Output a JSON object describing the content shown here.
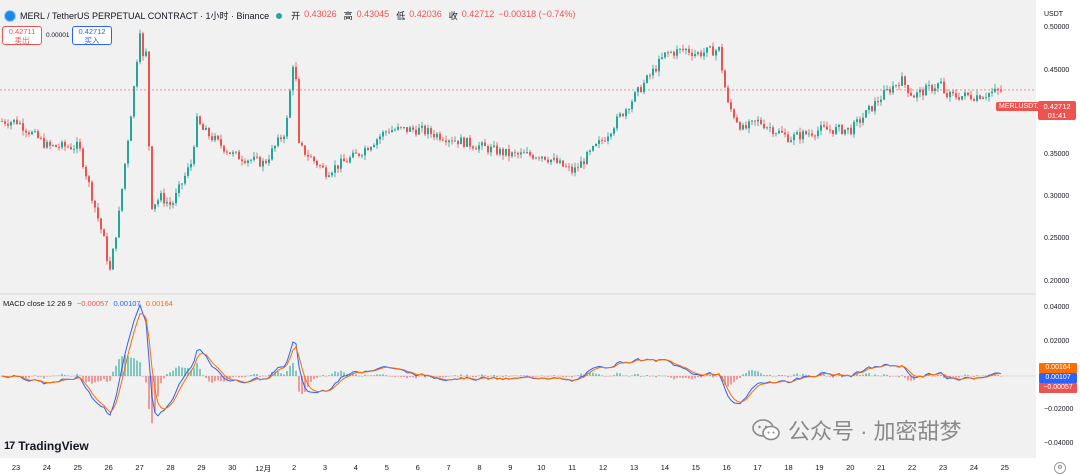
{
  "header": {
    "title": "MERL / TetherUS PERPETUAL CONTRACT · 1小时 · Binance",
    "open_label": "开",
    "open": "0.43026",
    "high_label": "高",
    "high": "0.43045",
    "low_label": "低",
    "low": "0.42036",
    "close_label": "收",
    "close": "0.42712",
    "change": "−0.00318 (−0.74%)"
  },
  "trade": {
    "sell_price": "0.42711",
    "sell_label": "卖出",
    "buy_price": "0.42712",
    "buy_label": "买入",
    "spread": "0.00001"
  },
  "price_axis": {
    "currency": "USDT",
    "labels": [
      "0.50000",
      "0.45000",
      "0.40000",
      "0.35000",
      "0.30000",
      "0.25000",
      "0.20000"
    ],
    "values": [
      0.5,
      0.45,
      0.4,
      0.35,
      0.3,
      0.25,
      0.2
    ]
  },
  "current_price": {
    "value": "0.42712",
    "countdown": "01:41",
    "symbol_tag": "MERLUSDT.P"
  },
  "macd": {
    "name": "MACD close 12 26 9",
    "hist": "−0.00057",
    "macd": "0.00107",
    "signal": "0.00164",
    "axis_labels": [
      "0.04000",
      "0.02000",
      "−0.02000",
      "−0.04000"
    ],
    "axis_values": [
      0.04,
      0.02,
      -0.02,
      -0.04
    ]
  },
  "time_axis": {
    "labels": [
      "23",
      "24",
      "25",
      "26",
      "27",
      "28",
      "29",
      "30",
      "12月",
      "2",
      "3",
      "4",
      "5",
      "6",
      "7",
      "8",
      "9",
      "10",
      "11",
      "12",
      "13",
      "14",
      "15",
      "16",
      "17",
      "18",
      "19",
      "20",
      "21",
      "22",
      "23",
      "24",
      "25"
    ]
  },
  "branding": {
    "logo_text": "TradingView",
    "logo_mark": "17",
    "watermark": "公众号 · 加密甜梦"
  },
  "colors": {
    "up": "#26a69a",
    "down": "#ef5350",
    "macd": "#2962ff",
    "signal": "#ff6d00"
  },
  "chart_data": {
    "type": "candlestick",
    "price_series_approx": [
      {
        "day": "23",
        "price": 0.39
      },
      {
        "day": "24",
        "price": 0.36
      },
      {
        "day": "25",
        "price": 0.36
      },
      {
        "day": "26",
        "price": 0.21
      },
      {
        "day": "27",
        "price": 0.46
      },
      {
        "day": "28",
        "price": 0.29
      },
      {
        "day": "29",
        "price": 0.38
      },
      {
        "day": "30",
        "price": 0.35
      },
      {
        "day": "12月",
        "price": 0.34
      },
      {
        "day": "2",
        "price": 0.46
      },
      {
        "day": "3",
        "price": 0.33
      },
      {
        "day": "4",
        "price": 0.35
      },
      {
        "day": "5",
        "price": 0.38
      },
      {
        "day": "6",
        "price": 0.38
      },
      {
        "day": "7",
        "price": 0.37
      },
      {
        "day": "8",
        "price": 0.36
      },
      {
        "day": "9",
        "price": 0.35
      },
      {
        "day": "10",
        "price": 0.35
      },
      {
        "day": "11",
        "price": 0.33
      },
      {
        "day": "12",
        "price": 0.37
      },
      {
        "day": "13",
        "price": 0.42
      },
      {
        "day": "14",
        "price": 0.47
      },
      {
        "day": "15",
        "price": 0.47
      },
      {
        "day": "16",
        "price": 0.41
      },
      {
        "day": "17",
        "price": 0.39
      },
      {
        "day": "18",
        "price": 0.37
      },
      {
        "day": "19",
        "price": 0.38
      },
      {
        "day": "20",
        "price": 0.38
      },
      {
        "day": "21",
        "price": 0.42
      },
      {
        "day": "22",
        "price": 0.42
      },
      {
        "day": "23",
        "price": 0.42
      },
      {
        "day": "24",
        "price": 0.42
      },
      {
        "day": "25",
        "price": 0.427
      }
    ],
    "current_price": 0.42712,
    "ylim": [
      0.19,
      0.51
    ],
    "macd_ylim": [
      -0.045,
      0.045
    ]
  }
}
